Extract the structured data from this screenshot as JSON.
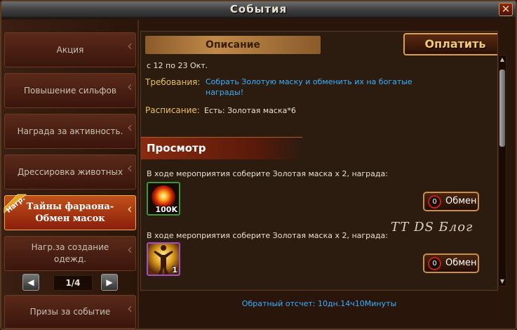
{
  "window": {
    "title": "События",
    "close_label": "✕"
  },
  "sidebar": {
    "items": [
      {
        "label": "Акция"
      },
      {
        "label": "Повышение сильфов"
      },
      {
        "label": "Награда за активность."
      },
      {
        "label": "Дрессировка животных"
      },
      {
        "label": "Тайны фараона-Обмен масок",
        "active": true,
        "badge": "Нагр."
      },
      {
        "label": "Нагр.за создание одежд."
      },
      {
        "label": "Призы за событие"
      }
    ],
    "pager": {
      "prev": "◀",
      "next": "▶",
      "page": "1/4"
    }
  },
  "main": {
    "description_header": "Описание",
    "pay_button": "Оплатить",
    "date_range": "с 12 по 23 Окт.",
    "requirements_label": "Требования:",
    "requirements_text": "Собрать Золотую маску и обменить их на богатые награды!",
    "schedule_label": "Расписание:",
    "schedule_text": "Есть: Золотая маска*6",
    "preview_header": "Просмотр",
    "tasks": [
      {
        "text": "В ходе мероприятия соберите Золотая маска x 2, награда:",
        "item_qty": "100K",
        "item_icon": "fire-orb-icon",
        "exchange_count": "0",
        "exchange_label": "Обмен"
      },
      {
        "text": "В ходе мероприятия соберите Золотая маска x 2, награда:",
        "item_qty": "1",
        "item_icon": "glowing-figure-icon",
        "exchange_count": "0",
        "exchange_label": "Обмен"
      }
    ],
    "watermark": "TT DS Блог",
    "countdown": "Обратный отсчет: 10дн.14ч10Минуты"
  },
  "colors": {
    "accent_blue": "#3ab0ff",
    "label_gold": "#e6c060",
    "active_tab": "#c0501a"
  }
}
